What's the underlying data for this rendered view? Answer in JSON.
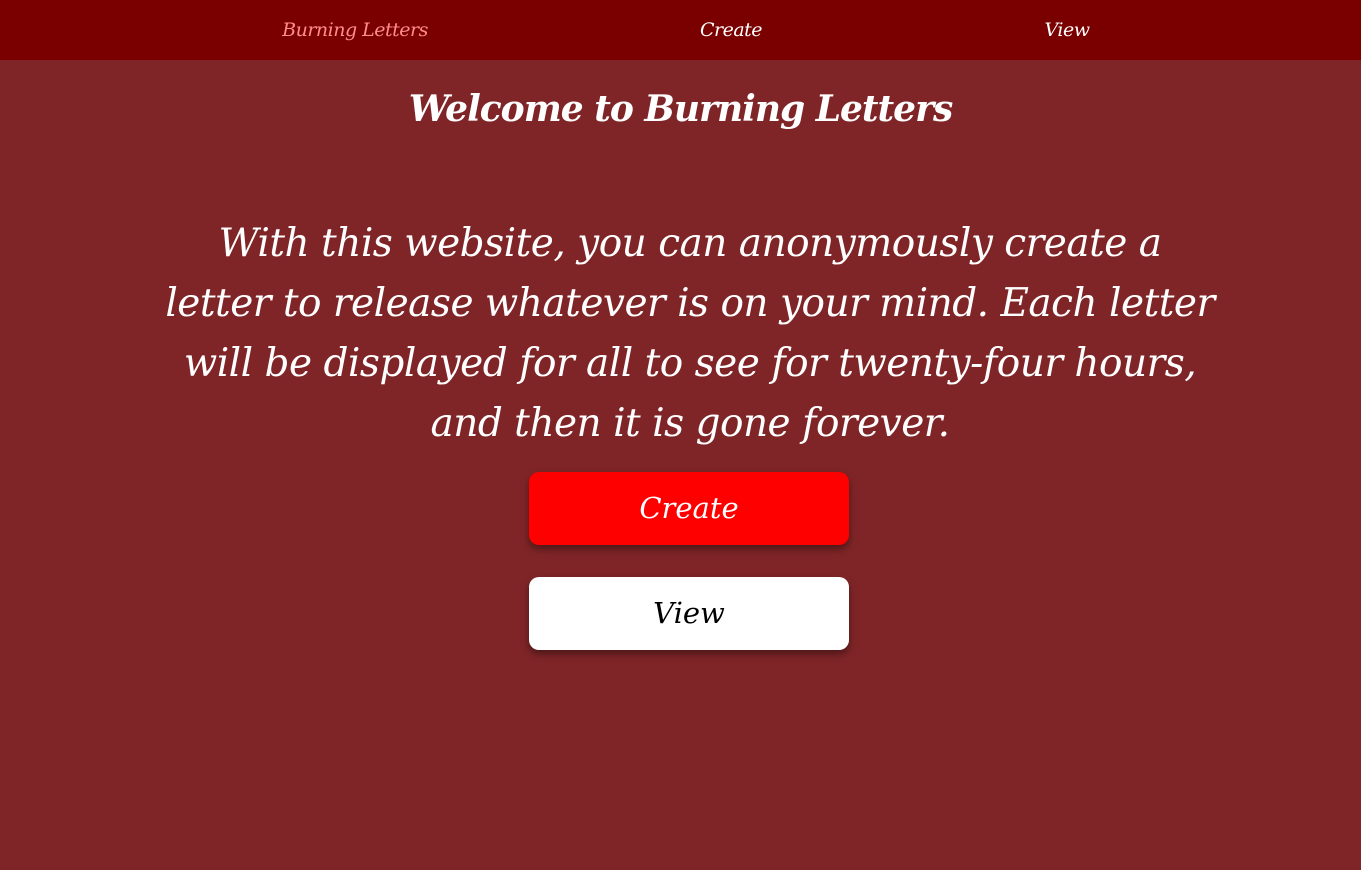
{
  "nav": {
    "brand": "Burning Letters",
    "create": "Create",
    "view": "View"
  },
  "main": {
    "title": "Welcome to Burning Letters",
    "intro": "With this website, you can anonymously create a letter to release whatever is on your mind. Each letter will be displayed for all to see for twenty-four hours, and then it is gone forever.",
    "create_button": "Create",
    "view_button": "View"
  },
  "colors": {
    "background": "#7f2527",
    "navbar": "#7a0000",
    "brand_text": "#ff8c8c",
    "create_button": "#ff0000",
    "view_button": "#ffffff"
  }
}
